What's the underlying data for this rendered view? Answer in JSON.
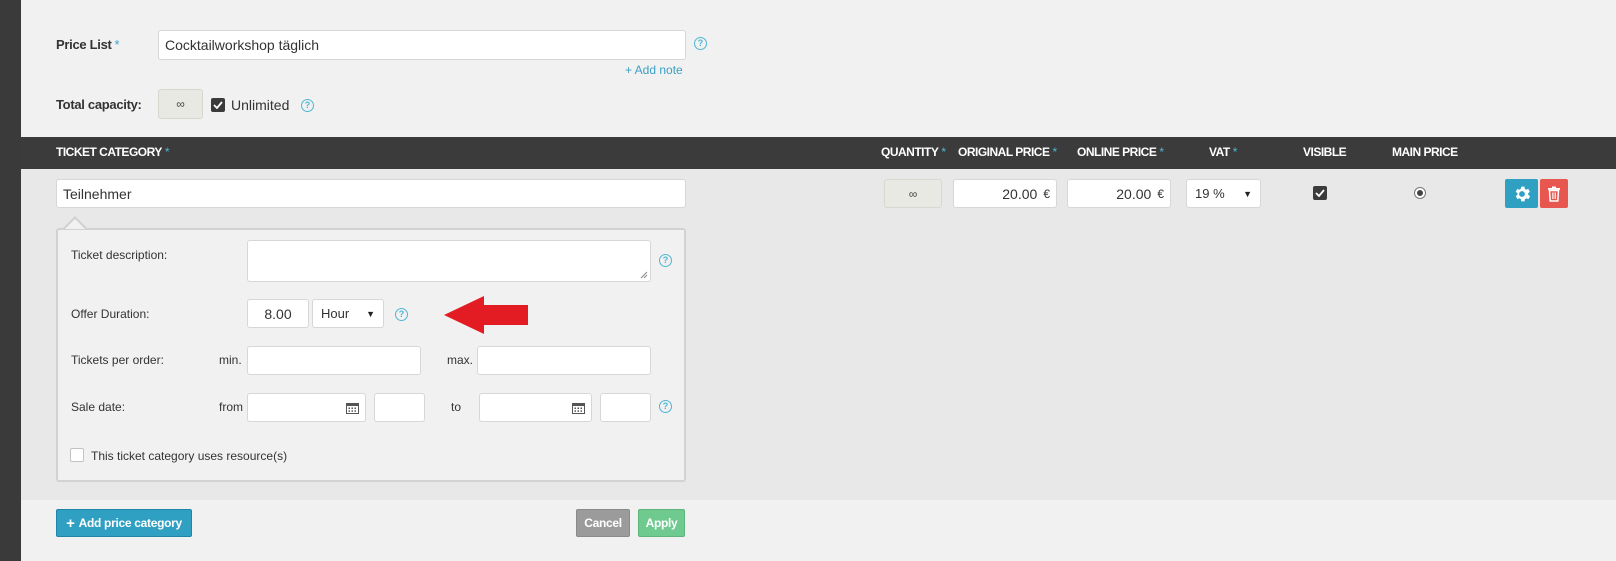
{
  "form": {
    "price_list_label": "Price List",
    "price_list_required": "*",
    "price_list_value": "Cocktailworkshop täglich",
    "add_note": "+ Add note",
    "total_capacity_label": "Total capacity:",
    "total_capacity_value": "∞",
    "unlimited_label": "Unlimited",
    "unlimited_checked": true
  },
  "table": {
    "headers": {
      "ticket_category": "TICKET CATEGORY",
      "quantity": "QUANTITY",
      "original_price": "ORIGINAL PRICE",
      "online_price": "ONLINE PRICE",
      "vat": "VAT",
      "visible": "VISIBLE",
      "main_price": "MAIN PRICE",
      "required": "*"
    },
    "row": {
      "category": "Teilnehmer",
      "quantity": "∞",
      "original_price": "20.00",
      "online_price": "20.00",
      "currency": "€",
      "vat": "19 %",
      "visible": true,
      "main_price": true
    }
  },
  "details": {
    "ticket_description_label": "Ticket description:",
    "ticket_description_value": "",
    "offer_duration_label": "Offer Duration:",
    "offer_duration_value": "8.00",
    "offer_duration_unit": "Hour",
    "tickets_per_order_label": "Tickets per order:",
    "min_label": "min.",
    "max_label": "max.",
    "sale_date_label": "Sale date:",
    "from_label": "from",
    "to_label": "to",
    "resources_label": "This ticket category uses resource(s)"
  },
  "footer": {
    "add_price_category": "Add price category",
    "add_icon": "+",
    "cancel": "Cancel",
    "apply": "Apply"
  },
  "colors": {
    "accent": "#2f9fc2",
    "delete": "#e8574f",
    "apply": "#6fca8f",
    "cancel": "#9b9b9b",
    "header": "#3b3b3b",
    "arrow": "#e31b23"
  },
  "icons": {
    "help": "help-circle-icon",
    "calendar": "calendar-icon",
    "settings": "gear-icon",
    "delete": "trash-icon",
    "annotation": "red-arrow-icon"
  }
}
